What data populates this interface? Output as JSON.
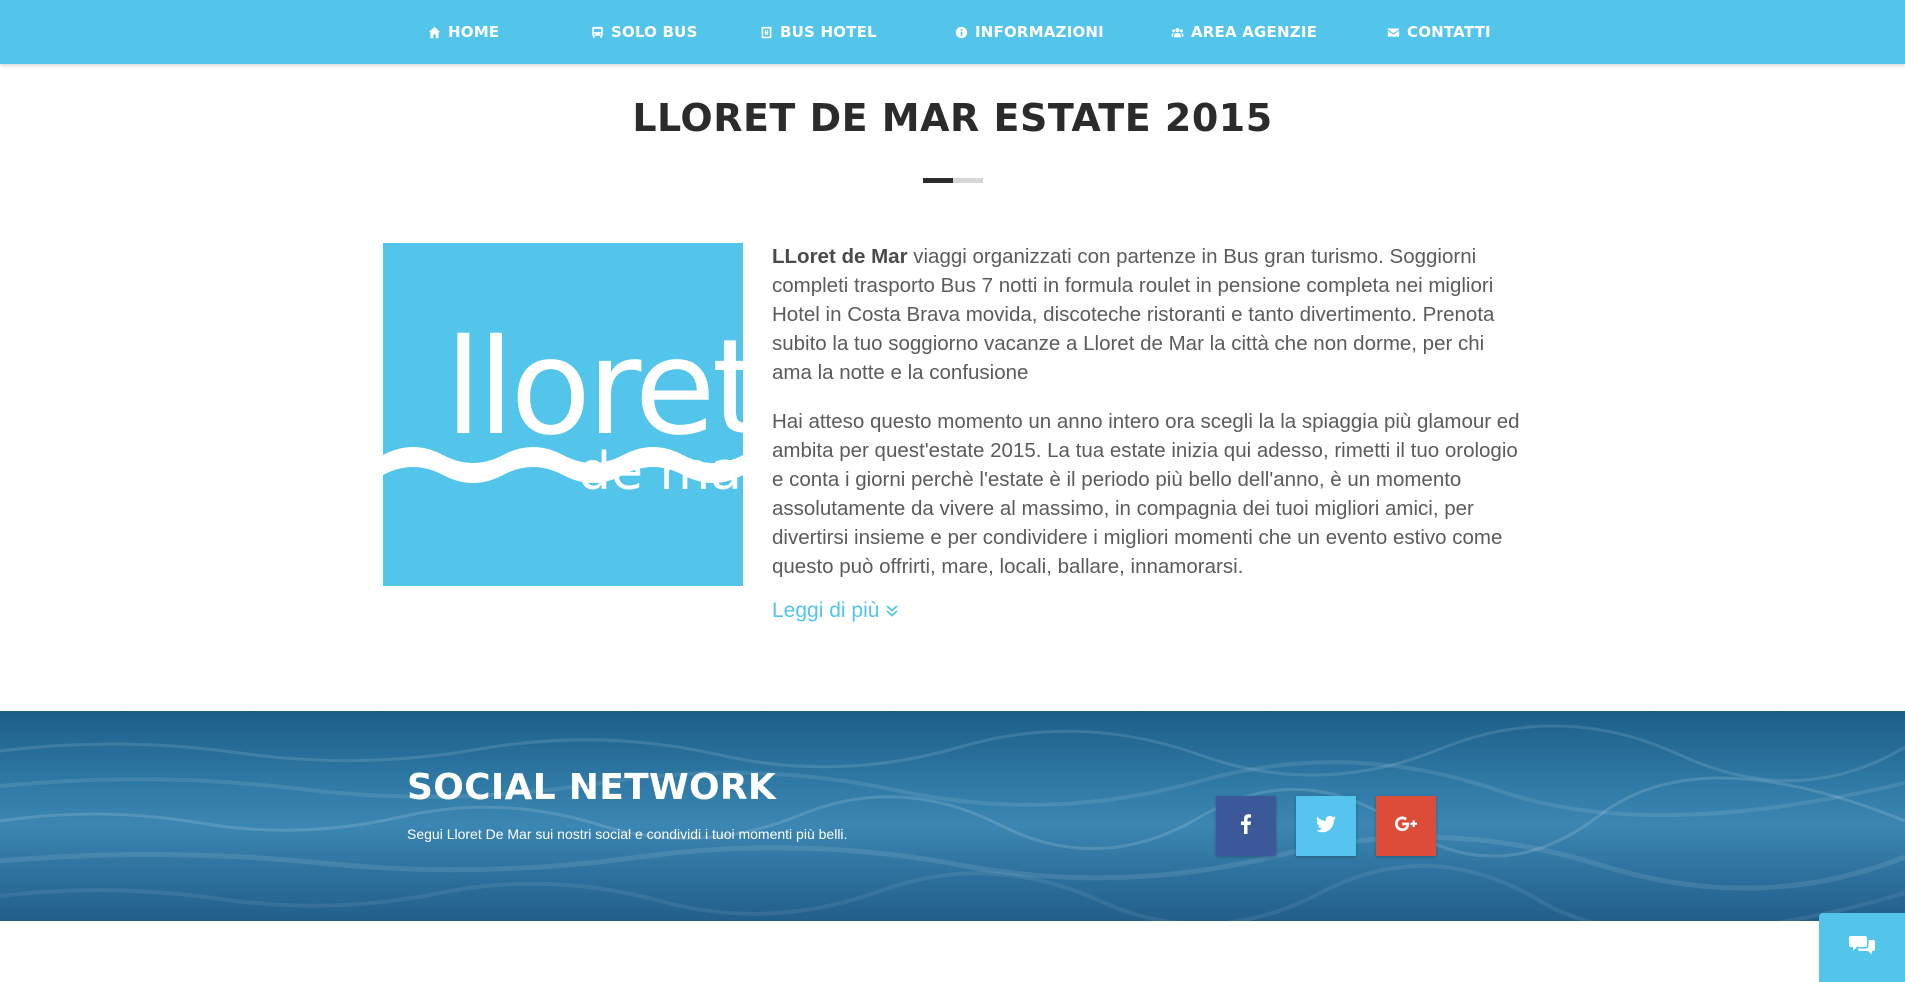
{
  "nav": {
    "items": [
      {
        "label": "HOME",
        "icon": "home-icon"
      },
      {
        "label": "SOLO BUS",
        "icon": "bus-icon"
      },
      {
        "label": "BUS HOTEL",
        "icon": "hotel-icon"
      },
      {
        "label": "INFORMAZIONI",
        "icon": "info-icon"
      },
      {
        "label": "AREA AGENZIE",
        "icon": "users-icon"
      },
      {
        "label": "CONTATTI",
        "icon": "envelope-icon"
      }
    ]
  },
  "page": {
    "title": "LLORET DE MAR ESTATE 2015"
  },
  "logo": {
    "text_main": "lloret",
    "text_sub": "de mar"
  },
  "content": {
    "p1_strong": "LLoret de Mar",
    "p1_rest": " viaggi organizzati con partenze in Bus gran turismo. Soggiorni completi trasporto Bus 7 notti in formula roulet in pensione completa nei migliori Hotel in Costa Brava movida, discoteche ristoranti e tanto divertimento. Prenota subito la tuo soggiorno vacanze a Lloret de Mar la città che non dorme, per chi ama la notte e la confusione",
    "p2": "Hai atteso questo momento un anno intero ora scegli la la spiaggia più glamour ed ambita per quest'estate 2015. La tua estate inizia qui adesso, rimetti il tuo orologio e conta i giorni perchè l'estate è il periodo più bello dell'anno, è un momento assolutamente da vivere al massimo, in compagnia dei tuoi migliori amici, per divertirsi insieme e per condividere i migliori momenti che un evento estivo come questo può offrirti, mare, locali, ballare, innamorarsi.",
    "read_more": "Leggi di più"
  },
  "social": {
    "title": "SOCIAL NETWORK",
    "subtitle": "Segui Lloret De Mar sui nostri social e condividi i tuoi momenti più belli.",
    "buttons": [
      {
        "icon": "facebook-icon",
        "color": "#3b5998"
      },
      {
        "icon": "twitter-icon",
        "color": "#55c5f0"
      },
      {
        "icon": "google-plus-icon",
        "color": "#dd4b39"
      }
    ]
  },
  "colors": {
    "brand": "#53c5ea",
    "title": "#2b2b2b",
    "text": "#5b5b5b"
  }
}
